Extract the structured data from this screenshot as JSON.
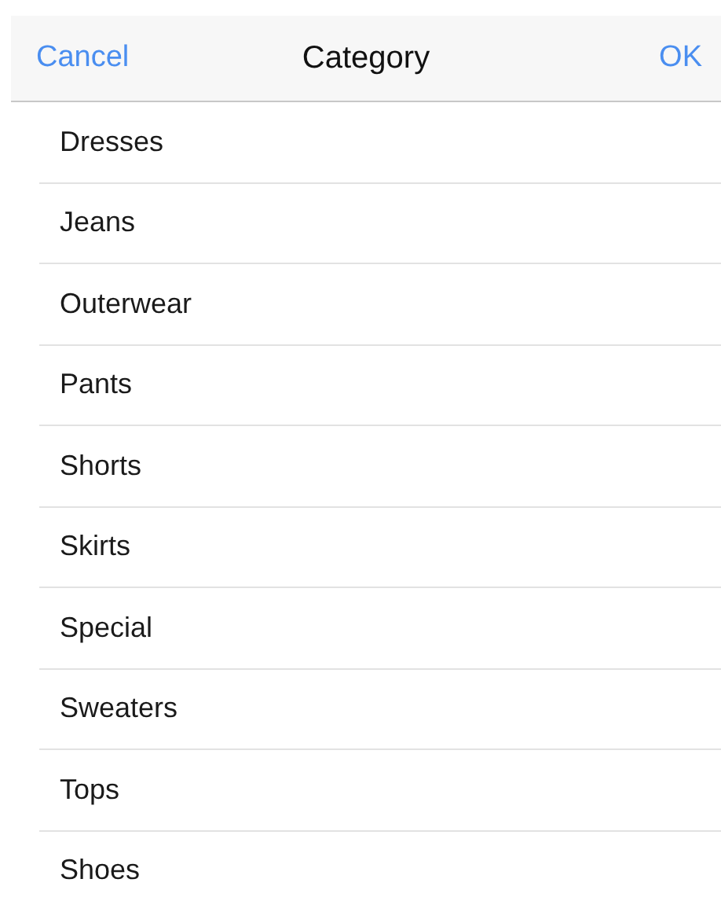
{
  "nav_bar": {
    "cancel": "Cancel",
    "title": "Category",
    "ok": "OK"
  },
  "items": [
    {
      "label": "Dresses"
    },
    {
      "label": "Jeans"
    },
    {
      "label": "Outerwear"
    },
    {
      "label": "Pants"
    },
    {
      "label": "Shorts"
    },
    {
      "label": "Skirts"
    },
    {
      "label": "Special"
    },
    {
      "label": "Sweaters"
    },
    {
      "label": "Tops"
    },
    {
      "label": "Shoes"
    }
  ]
}
